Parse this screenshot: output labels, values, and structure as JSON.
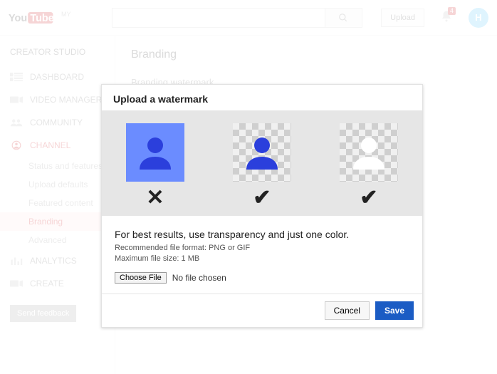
{
  "header": {
    "logo_text_left": "You",
    "logo_text_right": "Tube",
    "logo_superscript": "MY",
    "search_placeholder": "",
    "upload_label": "Upload",
    "notification_count": "4",
    "avatar_initial": "H"
  },
  "sidebar": {
    "title": "CREATOR STUDIO",
    "items": [
      {
        "label": "DASHBOARD"
      },
      {
        "label": "VIDEO MANAGER"
      },
      {
        "label": "COMMUNITY"
      },
      {
        "label": "CHANNEL"
      },
      {
        "label": "ANALYTICS"
      },
      {
        "label": "CREATE"
      }
    ],
    "channel_sub": [
      "Status and features",
      "Upload defaults",
      "Featured content",
      "Branding",
      "Advanced"
    ],
    "feedback_label": "Send feedback"
  },
  "content": {
    "page_title": "Branding",
    "section_title": "Branding watermark"
  },
  "modal": {
    "title": "Upload a watermark",
    "marks": {
      "bad": "✕",
      "good1": "✔",
      "good2": "✔"
    },
    "tip": "For best results, use transparency and just one color.",
    "format_line": "Recommended file format: PNG or GIF",
    "size_line": "Maximum file size: 1 MB",
    "choose_label": "Choose File",
    "no_file_label": "No file chosen",
    "cancel_label": "Cancel",
    "save_label": "Save"
  }
}
